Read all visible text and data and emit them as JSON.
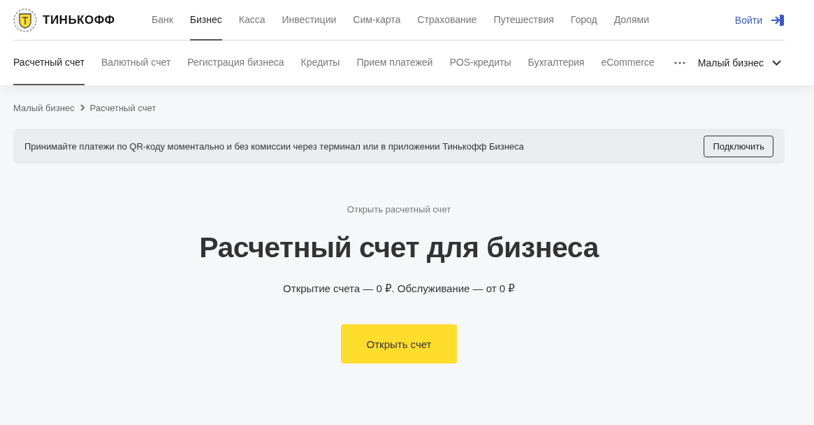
{
  "logo": {
    "text": "ТИНЬКОФФ"
  },
  "top_nav": [
    {
      "label": "Банк",
      "selected": false
    },
    {
      "label": "Бизнес",
      "selected": true
    },
    {
      "label": "Касса",
      "selected": false
    },
    {
      "label": "Инвестиции",
      "selected": false
    },
    {
      "label": "Сим-карта",
      "selected": false
    },
    {
      "label": "Страхование",
      "selected": false
    },
    {
      "label": "Путешествия",
      "selected": false
    },
    {
      "label": "Город",
      "selected": false
    },
    {
      "label": "Долями",
      "selected": false
    }
  ],
  "login": {
    "label": "Войти"
  },
  "sub_nav": [
    {
      "label": "Расчетный счет",
      "selected": true
    },
    {
      "label": "Валютный счет",
      "selected": false
    },
    {
      "label": "Регистрация бизнеса",
      "selected": false
    },
    {
      "label": "Кредиты",
      "selected": false
    },
    {
      "label": "Прием платежей",
      "selected": false
    },
    {
      "label": "POS-кредиты",
      "selected": false
    },
    {
      "label": "Бухгалтерия",
      "selected": false
    },
    {
      "label": "eCommerce",
      "selected": false
    }
  ],
  "segment": {
    "label": "Малый бизнес"
  },
  "breadcrumbs": [
    "Малый бизнес",
    "Расчетный счет"
  ],
  "banner": {
    "text": "Принимайте платежи по QR-коду моментально и без комиссии через терминал или в приложении Тинькофф Бизнеса",
    "button": "Подключить"
  },
  "hero": {
    "eyebrow": "Открыть расчетный счет",
    "title": "Расчетный счет для бизнеса",
    "subtitle": "Открытие счета — 0 ₽. Обслуживание — от 0 ₽",
    "button": "Открыть счет"
  }
}
